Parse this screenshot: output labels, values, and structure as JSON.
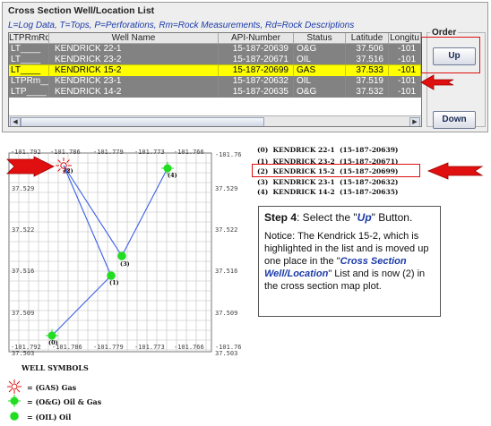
{
  "panel": {
    "title": "Cross Section Well/Location List",
    "legend": "L=Log Data, T=Tops, P=Perforations, Rm=Rock Measurements, Rd=Rock Descriptions"
  },
  "table": {
    "columns": [
      "LTPRmRd",
      "Well Name",
      "API-Number",
      "Status",
      "Latitude",
      "Longitu"
    ],
    "rows": [
      {
        "ltprmrd": "LT____",
        "well": "KENDRICK 22-1",
        "api": "15-187-20639",
        "status": "O&G",
        "lat": "37.506",
        "lon": "-101"
      },
      {
        "ltprmrd": "LT____",
        "well": "KENDRICK 23-2",
        "api": "15-187-20671",
        "status": "OIL",
        "lat": "37.516",
        "lon": "-101"
      },
      {
        "ltprmrd": "LT____",
        "well": "KENDRICK 15-2",
        "api": "15-187-20699",
        "status": "GAS",
        "lat": "37.533",
        "lon": "-101"
      },
      {
        "ltprmrd": "LTPRm__",
        "well": "KENDRICK 23-1",
        "api": "15-187-20632",
        "status": "OIL",
        "lat": "37.519",
        "lon": "-101"
      },
      {
        "ltprmrd": "LTP____",
        "well": "KENDRICK 14-2",
        "api": "15-187-20635",
        "status": "O&G",
        "lat": "37.532",
        "lon": "-101"
      }
    ],
    "selected_row": 2
  },
  "order": {
    "label": "Order",
    "up_label": "Up",
    "down_label": "Down"
  },
  "map": {
    "lon_ticks_top": [
      "-101.792",
      "-101.786",
      "-101.779",
      "-101.773",
      "-101.766"
    ],
    "lon_ticks_bottom": [
      "-101.792",
      "-101.786",
      "-101.779",
      "-101.773",
      "-101.766"
    ],
    "lat_ticks_left": [
      "37.529",
      "37.522",
      "37.516",
      "37.509",
      "37.503"
    ],
    "lat_ticks_right": [
      "-101.76",
      "37.529",
      "37.522",
      "37.516",
      "37.509",
      "-101.76",
      "37.503"
    ],
    "well_markers": [
      "(0)",
      "(1)",
      "(2)",
      "(3)",
      "(4)"
    ]
  },
  "well_list": [
    "(0)  KENDRICK 22-1  (15-187-20639)",
    "(1)  KENDRICK 23-2  (15-187-20671)",
    "(2)  KENDRICK 15-2  (15-187-20699)",
    "(3)  KENDRICK 23-1  (15-187-20632)",
    "(4)  KENDRICK 14-2  (15-187-20635)"
  ],
  "info": {
    "step_label": "Step 4",
    "step_text_a": ": Select the \"",
    "step_button": "Up",
    "step_text_b": "\" Button.",
    "notice_a": "Notice: The Kendrick 15-2, which is highlighted in the list and is moved up one place in the \"",
    "notice_list": "Cross Section Well/Location",
    "notice_b": "\" List and is now (2) in the cross section map plot."
  },
  "well_symbols": {
    "title": "WELL SYMBOLS",
    "gas": "= (GAS) Gas",
    "oil_gas": "= (O&G) Oil & Gas",
    "oil": "= (OIL) Oil"
  },
  "colors": {
    "row_grey": "#828282",
    "row_selected": "#ffff00",
    "well_green": "#22dd22",
    "arrow_red": "#e01010",
    "track_blue": "#3a5fe6"
  }
}
